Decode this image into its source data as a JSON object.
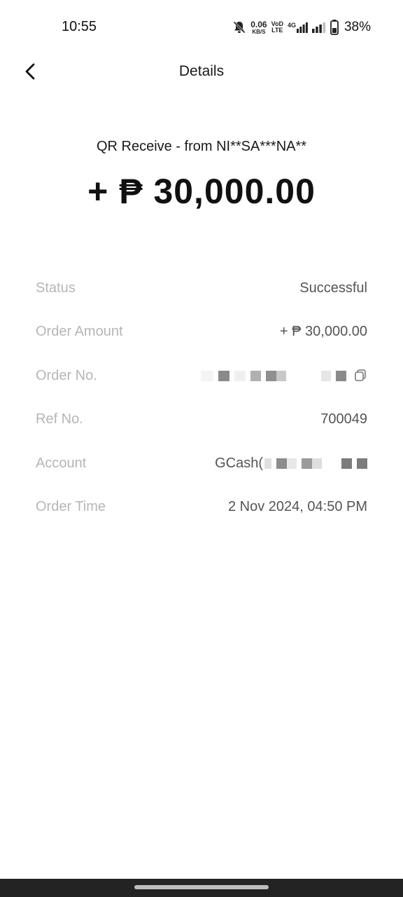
{
  "status_bar": {
    "time": "10:55",
    "net_speed_value": "0.06",
    "net_speed_unit": "KB/S",
    "volte_top": "VoD",
    "volte_bottom": "LTE",
    "network_type": "4G",
    "battery": "38%"
  },
  "header": {
    "title": "Details"
  },
  "summary": {
    "description": "QR Receive - from NI**SA***NA**",
    "amount": "+ ₱ 30,000.00"
  },
  "details": {
    "status_label": "Status",
    "status_value": "Successful",
    "order_amount_label": "Order Amount",
    "order_amount_value": "+ ₱ 30,000.00",
    "order_no_label": "Order No.",
    "ref_no_label": "Ref No.",
    "ref_no_value": "700049",
    "account_label": "Account",
    "account_value": "GCash(",
    "order_time_label": "Order Time",
    "order_time_value": "2 Nov 2024, 04:50 PM"
  },
  "icons": {
    "back": "chevron-left-icon",
    "copy": "copy-icon",
    "mute": "bell-off-icon",
    "signal": "signal-icon",
    "battery": "battery-icon"
  }
}
